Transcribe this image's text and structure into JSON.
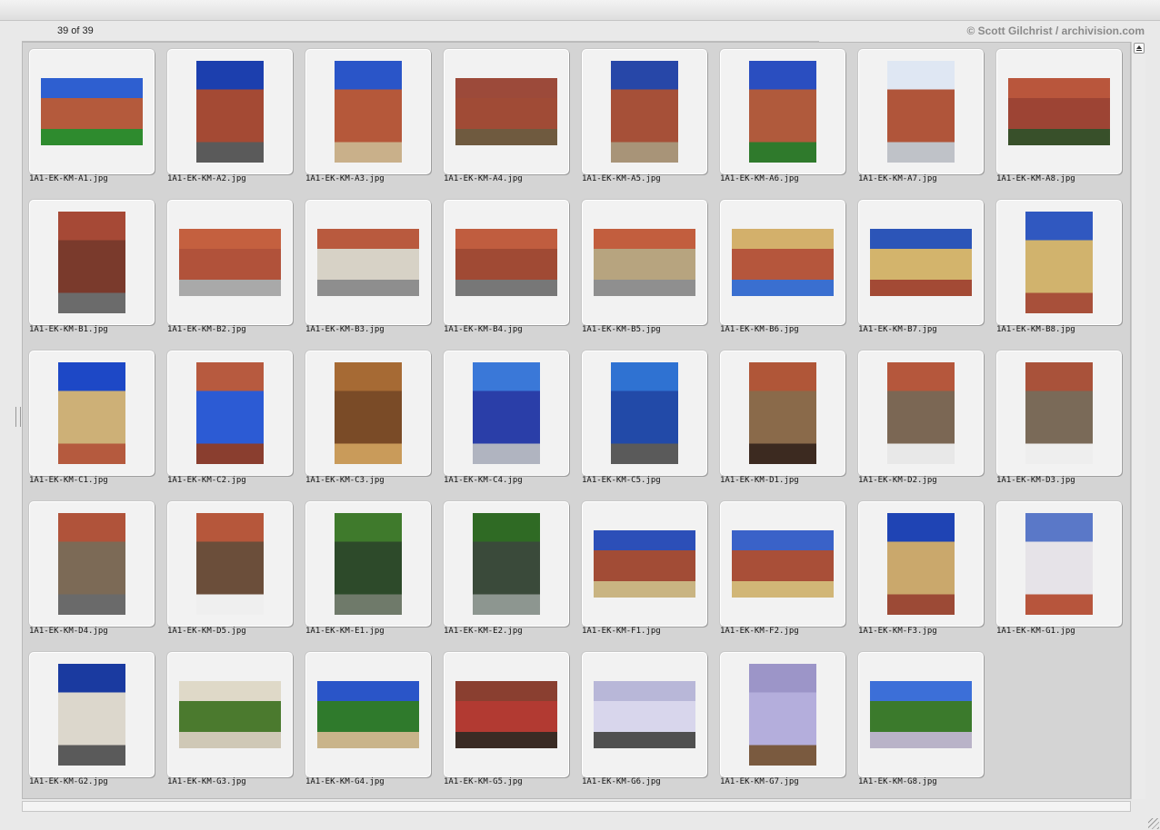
{
  "header": {
    "count_label": "39 of 39",
    "credit": "© Scott Gilchrist / archivision.com"
  },
  "thumbnails": [
    {
      "file": "1A1-EK-KM-A1.jpg",
      "orientation": "landscape",
      "subject": "courtyard lawn and red block",
      "colors": [
        "#2e5fd0",
        "#b45a3c",
        "#2e8b2e"
      ]
    },
    {
      "file": "1A1-EK-KM-A2.jpg",
      "orientation": "portrait",
      "subject": "street along red facade",
      "colors": [
        "#1c3fae",
        "#a44a34",
        "#5a5a5a"
      ]
    },
    {
      "file": "1A1-EK-KM-A3.jpg",
      "orientation": "portrait",
      "subject": "arches and balconies",
      "colors": [
        "#2a55c8",
        "#b5583a",
        "#c9b08a"
      ]
    },
    {
      "file": "1A1-EK-KM-A4.jpg",
      "orientation": "landscape",
      "subject": "arcade of arches",
      "colors": [
        "#9c4a3a",
        "#a04b36",
        "#6f5a3f"
      ]
    },
    {
      "file": "1A1-EK-KM-A5.jpg",
      "orientation": "portrait",
      "subject": "central tower block",
      "colors": [
        "#2747a8",
        "#a65038",
        "#a89478"
      ]
    },
    {
      "file": "1A1-EK-KM-A6.jpg",
      "orientation": "portrait",
      "subject": "block with yellow towers",
      "colors": [
        "#2a4ec0",
        "#b05a3c",
        "#2f7a2c"
      ]
    },
    {
      "file": "1A1-EK-KM-A7.jpg",
      "orientation": "portrait",
      "subject": "facade in pale sky",
      "colors": [
        "#dfe7f3",
        "#b0553a",
        "#bfc2c8"
      ]
    },
    {
      "file": "1A1-EK-KM-A8.jpg",
      "orientation": "landscape",
      "subject": "large arch passage",
      "colors": [
        "#b9563c",
        "#9d4434",
        "#38502a"
      ]
    },
    {
      "file": "1A1-EK-KM-B1.jpg",
      "orientation": "portrait",
      "subject": "corner balconies",
      "colors": [
        "#a64936",
        "#7a3a2c",
        "#6b6b6b"
      ]
    },
    {
      "file": "1A1-EK-KM-B2.jpg",
      "orientation": "landscape",
      "subject": "arch opening front view",
      "colors": [
        "#c4603f",
        "#b1523a",
        "#a9a9a9"
      ]
    },
    {
      "file": "1A1-EK-KM-B3.jpg",
      "orientation": "landscape",
      "subject": "inside arch vault",
      "colors": [
        "#b95a3e",
        "#d7d2c6",
        "#8e8e8e"
      ]
    },
    {
      "file": "1A1-EK-KM-B4.jpg",
      "orientation": "landscape",
      "subject": "doorway on red wall",
      "colors": [
        "#c05d3f",
        "#a04a34",
        "#777777"
      ]
    },
    {
      "file": "1A1-EK-KM-B5.jpg",
      "orientation": "landscape",
      "subject": "doorway angled view",
      "colors": [
        "#c25e3e",
        "#b7a47f",
        "#8f8f8f"
      ]
    },
    {
      "file": "1A1-EK-KM-B6.jpg",
      "orientation": "landscape",
      "subject": "yellow and red facade",
      "colors": [
        "#d3b06b",
        "#b5563c",
        "#3a6fd0"
      ]
    },
    {
      "file": "1A1-EK-KM-B7.jpg",
      "orientation": "landscape",
      "subject": "KARL MARX-HOF lettering",
      "colors": [
        "#2c55b8",
        "#d3b46c",
        "#a34a35"
      ]
    },
    {
      "file": "1A1-EK-KM-B8.jpg",
      "orientation": "portrait",
      "subject": "stepped yellow tower",
      "colors": [
        "#3058c0",
        "#d1b36d",
        "#a8503a"
      ]
    },
    {
      "file": "1A1-EK-KM-C1.jpg",
      "orientation": "portrait",
      "subject": "flagpole against sky",
      "colors": [
        "#1d48c6",
        "#cdb077",
        "#b55a3e"
      ]
    },
    {
      "file": "1A1-EK-KM-C2.jpg",
      "orientation": "portrait",
      "subject": "blue balcony rails",
      "colors": [
        "#b75a3f",
        "#2c5bd4",
        "#8a3e2f"
      ]
    },
    {
      "file": "1A1-EK-KM-C3.jpg",
      "orientation": "portrait",
      "subject": "wooden door detail",
      "colors": [
        "#a66a34",
        "#7a4b27",
        "#c99b5a"
      ]
    },
    {
      "file": "1A1-EK-KM-C4.jpg",
      "orientation": "portrait",
      "subject": "blue street lamp",
      "colors": [
        "#3a78d8",
        "#2a3ea8",
        "#b0b4c0"
      ]
    },
    {
      "file": "1A1-EK-KM-C5.jpg",
      "orientation": "portrait",
      "subject": "tall lamp pole",
      "colors": [
        "#2f72d2",
        "#224aa8",
        "#5a5a5a"
      ]
    },
    {
      "file": "1A1-EK-KM-D1.jpg",
      "orientation": "portrait",
      "subject": "statue on facade",
      "colors": [
        "#b05638",
        "#8a6a4a",
        "#3c2a20"
      ]
    },
    {
      "file": "1A1-EK-KM-D2.jpg",
      "orientation": "portrait",
      "subject": "statue with child",
      "colors": [
        "#b5573c",
        "#7b6754",
        "#e8e8e8"
      ]
    },
    {
      "file": "1A1-EK-KM-D3.jpg",
      "orientation": "portrait",
      "subject": "statue by window",
      "colors": [
        "#a9523a",
        "#7a6a58",
        "#eeeeee"
      ]
    },
    {
      "file": "1A1-EK-KM-D4.jpg",
      "orientation": "portrait",
      "subject": "statue on pedestal",
      "colors": [
        "#b0533a",
        "#7c6a56",
        "#6a6a6a"
      ]
    },
    {
      "file": "1A1-EK-KM-D5.jpg",
      "orientation": "portrait",
      "subject": "draped statue",
      "colors": [
        "#b6573b",
        "#6b4e3a",
        "#efefef"
      ]
    },
    {
      "file": "1A1-EK-KM-E1.jpg",
      "orientation": "portrait",
      "subject": "bronze figure in trees",
      "colors": [
        "#3f7a2c",
        "#2d4a2a",
        "#6f7a6a"
      ]
    },
    {
      "file": "1A1-EK-KM-E2.jpg",
      "orientation": "portrait",
      "subject": "bronze figure close",
      "colors": [
        "#2f6a24",
        "#3a4a3a",
        "#8d9690"
      ]
    },
    {
      "file": "1A1-EK-KM-F1.jpg",
      "orientation": "landscape",
      "subject": "long street facade",
      "colors": [
        "#2c4fb8",
        "#a24c36",
        "#c9b482"
      ]
    },
    {
      "file": "1A1-EK-KM-F2.jpg",
      "orientation": "landscape",
      "subject": "block with trees",
      "colors": [
        "#3a62c8",
        "#a94f38",
        "#d1b677"
      ]
    },
    {
      "file": "1A1-EK-KM-F3.jpg",
      "orientation": "portrait",
      "subject": "yellow corner block",
      "colors": [
        "#1f44b4",
        "#caa86c",
        "#9c4a36"
      ]
    },
    {
      "file": "1A1-EK-KM-G1.jpg",
      "orientation": "portrait",
      "subject": "white blocks and trees",
      "colors": [
        "#5a78c8",
        "#e6e3e8",
        "#b7553c"
      ]
    },
    {
      "file": "1A1-EK-KM-G2.jpg",
      "orientation": "portrait",
      "subject": "street with cafe",
      "colors": [
        "#1a3aa0",
        "#dcd7cc",
        "#5a5a5a"
      ]
    },
    {
      "file": "1A1-EK-KM-G3.jpg",
      "orientation": "landscape",
      "subject": "street and trees",
      "colors": [
        "#dfd9c8",
        "#4b7a2e",
        "#cfc8b6"
      ]
    },
    {
      "file": "1A1-EK-KM-G4.jpg",
      "orientation": "landscape",
      "subject": "park with buildings",
      "colors": [
        "#2a55c8",
        "#2f7a2c",
        "#c9b48a"
      ]
    },
    {
      "file": "1A1-EK-KM-G5.jpg",
      "orientation": "landscape",
      "subject": "red gate entrance",
      "colors": [
        "#8a3f30",
        "#b23a32",
        "#3a2b24"
      ]
    },
    {
      "file": "1A1-EK-KM-G6.jpg",
      "orientation": "landscape",
      "subject": "arch with parked cars",
      "colors": [
        "#b8b7d8",
        "#d8d6ec",
        "#505050"
      ]
    },
    {
      "file": "1A1-EK-KM-G7.jpg",
      "orientation": "portrait",
      "subject": "lilac facade doorway",
      "colors": [
        "#9c95c8",
        "#b4aedc",
        "#7a5a3f"
      ]
    },
    {
      "file": "1A1-EK-KM-G8.jpg",
      "orientation": "landscape",
      "subject": "street with trees and cars",
      "colors": [
        "#3c6fd8",
        "#3b7a2c",
        "#b9b3c8"
      ]
    }
  ]
}
